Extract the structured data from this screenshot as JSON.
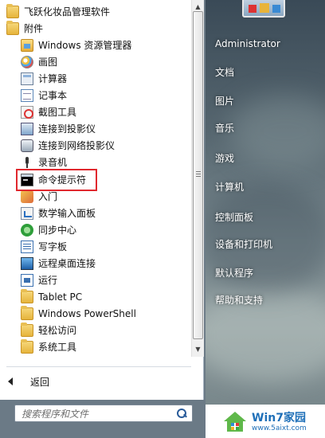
{
  "programs": {
    "items": [
      {
        "label": "飞跃化妆品管理软件",
        "icon": "folder-icon"
      },
      {
        "label": "附件",
        "icon": "folder-icon"
      },
      {
        "label": "Windows 资源管理器",
        "icon": "explorer-icon"
      },
      {
        "label": "画图",
        "icon": "paint-icon"
      },
      {
        "label": "计算器",
        "icon": "calculator-icon"
      },
      {
        "label": "记事本",
        "icon": "notepad-icon"
      },
      {
        "label": "截图工具",
        "icon": "snipping-tool-icon"
      },
      {
        "label": "连接到投影仪",
        "icon": "projector-icon"
      },
      {
        "label": "连接到网络投影仪",
        "icon": "network-projector-icon"
      },
      {
        "label": "录音机",
        "icon": "microphone-icon"
      },
      {
        "label": "命令提示符",
        "icon": "command-prompt-icon"
      },
      {
        "label": "入门",
        "icon": "getting-started-icon"
      },
      {
        "label": "数学输入面板",
        "icon": "math-input-icon"
      },
      {
        "label": "同步中心",
        "icon": "sync-center-icon"
      },
      {
        "label": "写字板",
        "icon": "wordpad-icon"
      },
      {
        "label": "远程桌面连接",
        "icon": "remote-desktop-icon"
      },
      {
        "label": "运行",
        "icon": "run-icon"
      },
      {
        "label": "Tablet PC",
        "icon": "folder-icon"
      },
      {
        "label": "Windows PowerShell",
        "icon": "folder-icon"
      },
      {
        "label": "轻松访问",
        "icon": "folder-icon"
      },
      {
        "label": "系统工具",
        "icon": "folder-icon"
      }
    ],
    "highlighted": "命令提示符",
    "highlight_color": "#e0282e"
  },
  "back": {
    "label": "返回"
  },
  "search": {
    "placeholder": "搜索程序和文件"
  },
  "right_menu": {
    "user": "Administrator",
    "items": [
      "文档",
      "图片",
      "音乐",
      "游戏",
      "计算机",
      "控制面板",
      "设备和打印机",
      "默认程序",
      "帮助和支持"
    ]
  },
  "watermark": {
    "title": "Win7家园",
    "url": "www.5aixt.com"
  }
}
